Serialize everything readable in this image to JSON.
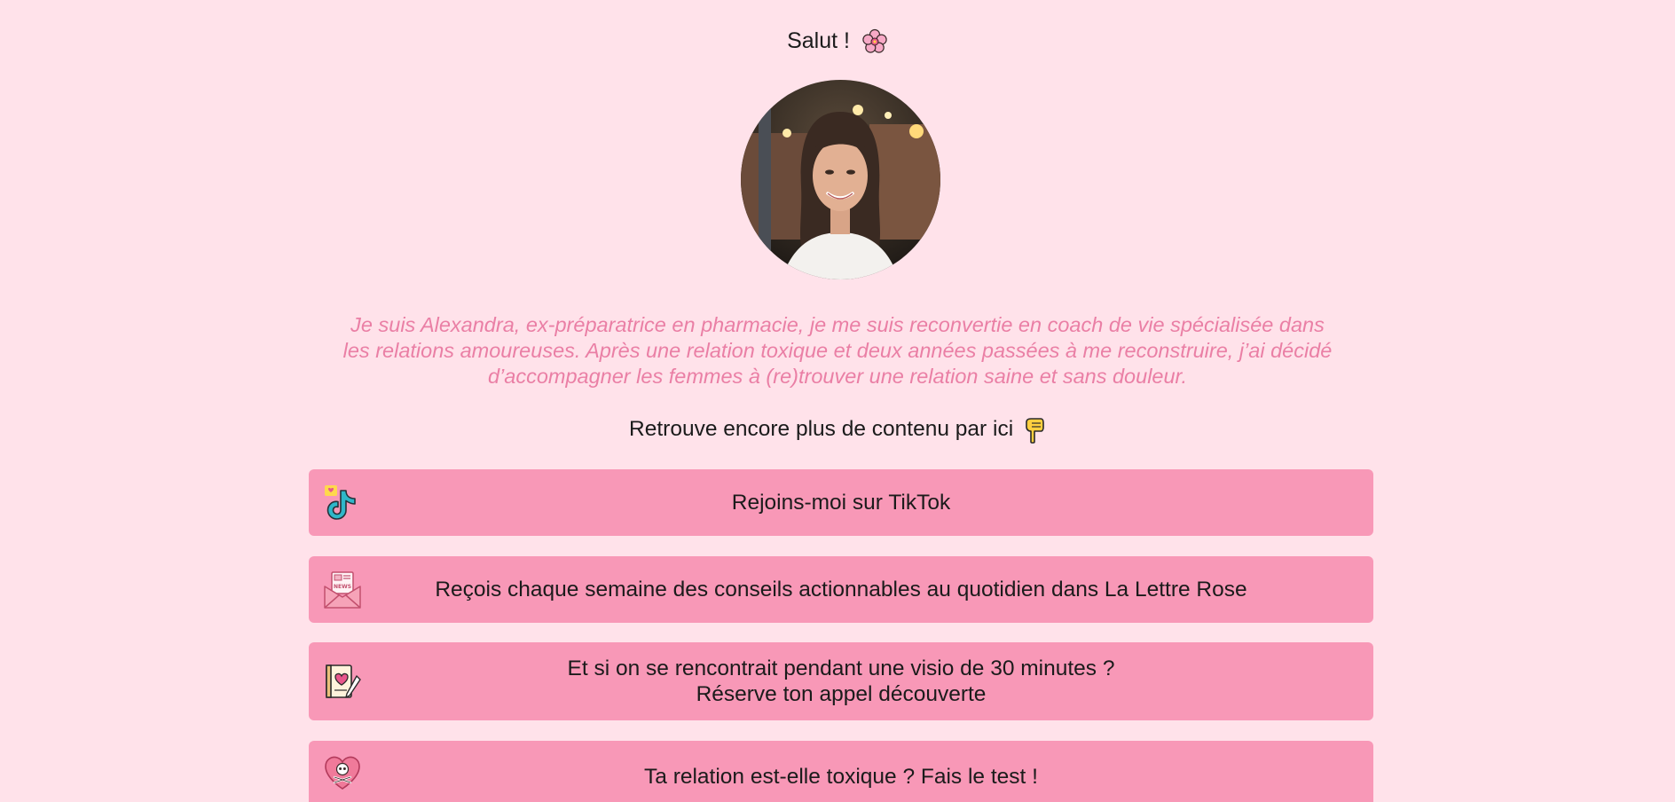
{
  "header": {
    "greeting": "Salut !",
    "greeting_emoji": "cherry-blossom-icon"
  },
  "profile": {
    "avatar": "profile-photo"
  },
  "bio": {
    "text": "Je suis Alexandra, ex-préparatrice en pharmacie, je me suis reconvertie en coach de vie spécialisée dans les relations amoureuses. Après une relation toxique et deux années passées à me reconstruire, j’ai décidé d’accompagner les femmes à (re)trouver une relation saine et sans douleur."
  },
  "more": {
    "text": "Retrouve encore plus de contenu par ici",
    "emoji": "pointing-down-hand-icon"
  },
  "links": [
    {
      "icon": "tiktok-icon",
      "label": "Rejoins-moi sur TikTok"
    },
    {
      "icon": "newsletter-icon",
      "label": "Reçois chaque semaine des conseils actionnables au quotidien dans La Lettre Rose"
    },
    {
      "icon": "notebook-heart-icon",
      "label_line1": "Et si on se rencontrait pendant une visio de 30 minutes ?",
      "label_line2": "Réserve ton appel découverte"
    },
    {
      "icon": "toxic-heart-icon",
      "label": "Ta relation est-elle toxique ? Fais le test !"
    }
  ],
  "colors": {
    "background": "#ffe2ea",
    "button": "#f898b7",
    "bio_text": "#ea7fa5"
  }
}
